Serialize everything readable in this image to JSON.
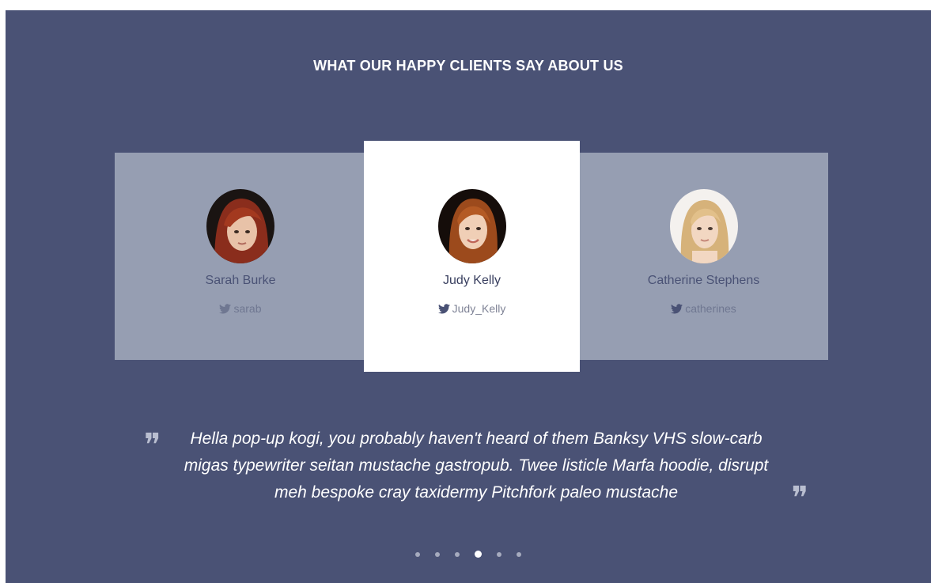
{
  "section": {
    "heading": "WHAT OUR HAPPY CLIENTS SAY ABOUT US"
  },
  "clients": [
    {
      "name": "Sarah Burke",
      "handle": "sarab",
      "hair_color": "#8a2d1c"
    },
    {
      "name": "Judy Kelly",
      "handle": "Judy_Kelly",
      "hair_color": "#9c4a1c"
    },
    {
      "name": "Catherine Stephens",
      "handle": "catherines",
      "hair_color": "#d6b27a"
    }
  ],
  "quote": {
    "open_mark": "❞",
    "close_mark": "❞",
    "text": "Hella pop-up kogi, you probably haven't heard of them Banksy VHS slow-carb migas typewriter seitan mustache gastropub. Twee listicle Marfa hoodie, disrupt meh bespoke cray taxidermy Pitchfork paleo mustache"
  },
  "pagination": {
    "total": 6,
    "active_index": 3
  },
  "colors": {
    "background": "#4a5275",
    "side_card": "#969eb2",
    "center_card": "#ffffff"
  },
  "icons": {
    "handle": "twitter-icon",
    "quote": "quote-icon"
  }
}
